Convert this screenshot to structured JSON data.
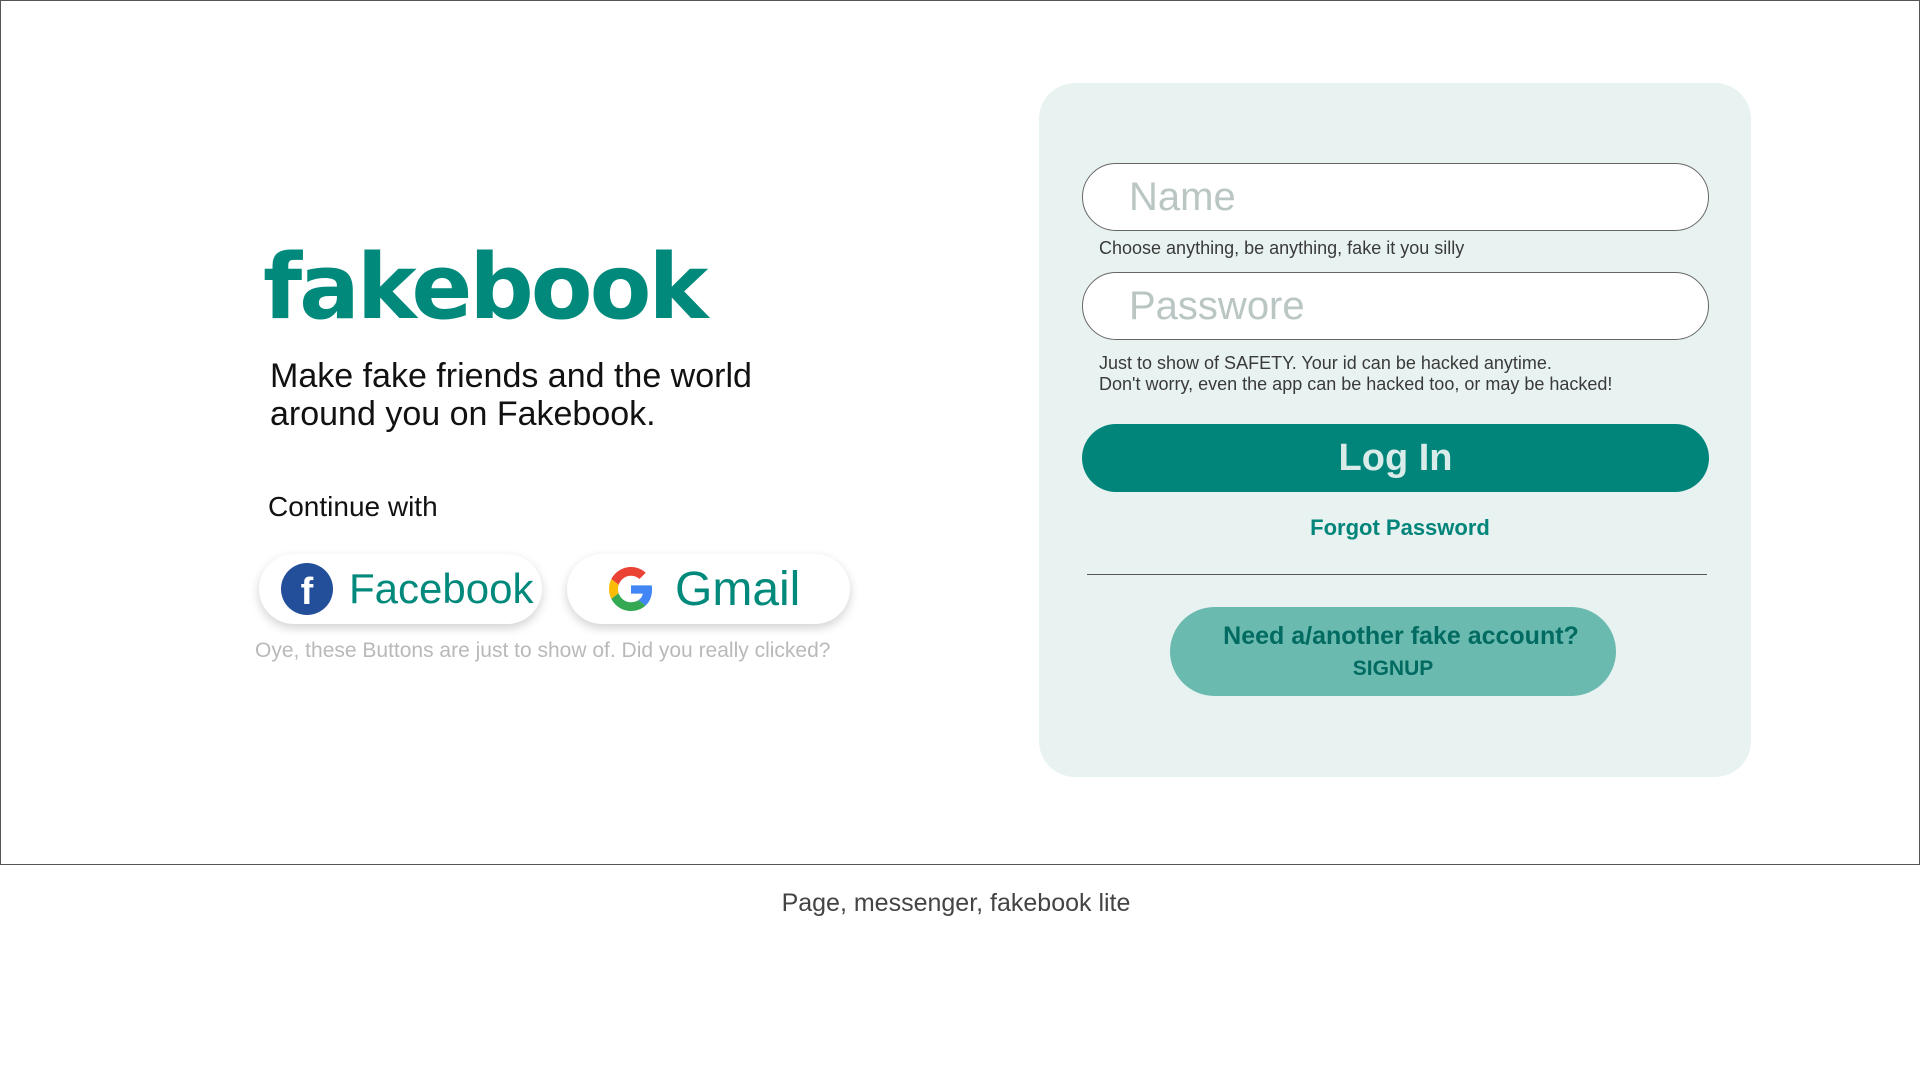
{
  "brand": {
    "logo_text": "fakebook",
    "tagline": "Make fake friends and the world around you on Fakebook.",
    "accent_color": "#01897b"
  },
  "social": {
    "continue_label": "Continue with",
    "facebook_label": "Facebook",
    "facebook_icon_glyph": "f",
    "gmail_label": "Gmail",
    "note": "Oye, these Buttons are just to show of. Did you really clicked?"
  },
  "login": {
    "name_placeholder": "Name",
    "name_hint": "Choose anything, be anything, fake it you silly",
    "password_placeholder": "Passwore",
    "password_hint_line1": "Just to show of SAFETY. Your id can be hacked anytime.",
    "password_hint_line2": "Don't worry, even the app can be hacked too, or may be hacked!",
    "login_label": "Log In",
    "forgot_label": "Forgot Password",
    "signup_line1": "Need a/another fake account?",
    "signup_line2": "SIGNUP"
  },
  "footer": {
    "links_text": "Page, messenger, fakebook lite"
  },
  "icons": {
    "facebook": "facebook-icon",
    "google": "google-icon"
  }
}
